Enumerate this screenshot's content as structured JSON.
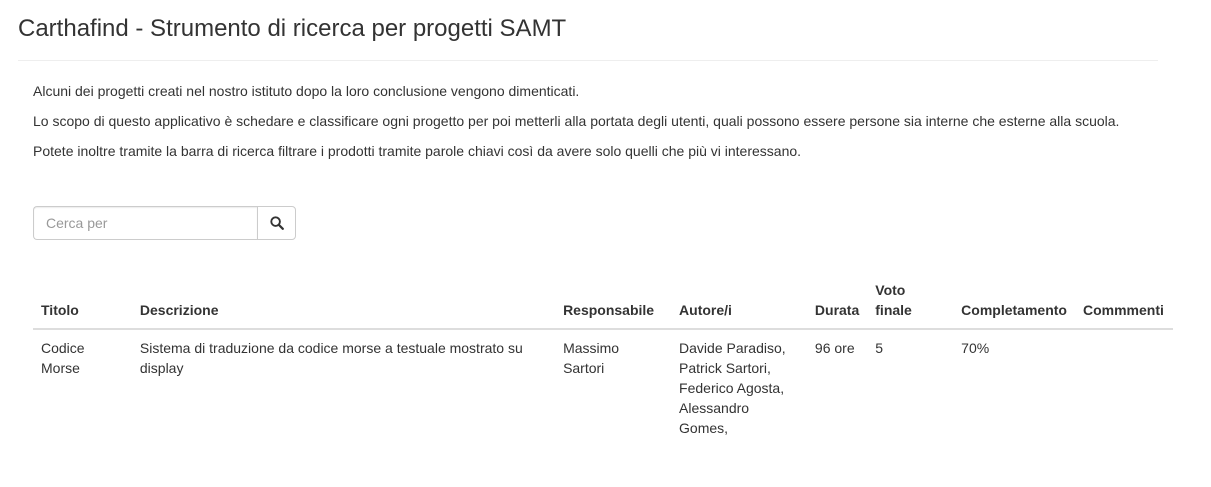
{
  "header": {
    "title": "Carthafind - Strumento di ricerca per progetti SAMT"
  },
  "intro": {
    "line1": "Alcuni dei progetti creati nel nostro istituto dopo la loro conclusione vengono dimenticati.",
    "line2": "Lo scopo di questo applicativo è schedare e classificare ogni progetto per poi metterli alla portata degli utenti, quali possono essere persone sia interne che esterne alla scuola.",
    "line3": "Potete inoltre tramite la barra di ricerca filtrare i prodotti tramite parole chiavi così da avere solo quelli che più vi interessano."
  },
  "search": {
    "placeholder": "Cerca per",
    "value": "",
    "button_icon": "search-icon"
  },
  "table": {
    "columns": [
      "Titolo",
      "Descrizione",
      "Responsabile",
      "Autore/i",
      "Durata",
      "Voto finale",
      "Completamento",
      "Commmenti"
    ],
    "rows": [
      {
        "titolo": "Codice Morse",
        "descrizione": "Sistema di traduzione da codice morse a testuale mostrato su display",
        "responsabile": "Massimo Sartori",
        "autori": "Davide Paradiso, Patrick Sartori, Federico Agosta, Alessandro Gomes,",
        "durata": "96 ore",
        "voto_finale": "5",
        "completamento": "70%",
        "commenti": ""
      }
    ]
  }
}
